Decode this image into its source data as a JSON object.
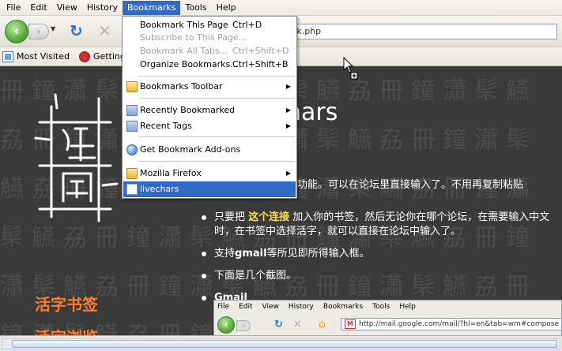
{
  "menubar": {
    "items": [
      {
        "label": "File"
      },
      {
        "label": "Edit"
      },
      {
        "label": "View"
      },
      {
        "label": "History"
      },
      {
        "label": "Bookmarks"
      },
      {
        "label": "Tools"
      },
      {
        "label": "Help"
      }
    ]
  },
  "navbar": {
    "url": "kmark.php"
  },
  "bookmarks_toolbar": {
    "items": [
      {
        "label": "Most Visited",
        "icon": "page-icon"
      },
      {
        "label": "Getting St",
        "icon": "getting-started-icon"
      }
    ]
  },
  "bookmarks_menu": {
    "items": [
      {
        "label": "Bookmark This Page",
        "shortcut": "Ctrl+D"
      },
      {
        "label": "Subscribe to This Page...",
        "shortcut": ""
      },
      {
        "label": "Bookmark All Tabs...",
        "shortcut": "Ctrl+Shift+D"
      },
      {
        "label": "Organize Bookmarks...",
        "shortcut": "Ctrl+Shift+B"
      },
      {
        "label": "Bookmarks Toolbar"
      },
      {
        "label": "Recently Bookmarked"
      },
      {
        "label": "Recent Tags"
      },
      {
        "label": "Get Bookmark Add-ons"
      },
      {
        "label": "Mozilla Firefox"
      },
      {
        "label": "livechars"
      }
    ]
  },
  "content": {
    "heading": "hars",
    "intro": "功能。可以在论坛里直接输入了。不用再复制粘贴",
    "bullets": {
      "b1_pre": "只要把 ",
      "b1_link": "这个连接",
      "b1_post": " 加入你的书签，然后无论你在哪个论坛，在需要输入中文时，在书签中选择活字，就可以直接在论坛中输入了。",
      "b2_bold": "gmail",
      "b2_pre": "支持",
      "b2_post": "等所见即所得输入框。",
      "b3": "下面是几个截图。",
      "b4": "Gmail"
    },
    "side_title": "活字书签",
    "side_title2": "活字浏览",
    "bg_pattern": "冊鐘瀟䯱觾劦冊鐘瀟䯱觾劦冊鐘瀟䯱觾劦冊鐘瀟䯱觾劦冊鐘瀟䯱觾劦冊鐘瀟䯱觾劦冊鐘瀟䯱觾劦冊鐘瀟䯱觾劦冊鐘瀟䯱觾劦冊鐘瀟䯱觾劦冊鐘瀟䯱觾劦冊鐘瀟䯱觾劦冊鐘瀟䯱觾劦冊鐘瀟䯱觾劦冊鐘瀟䯱觾劦冊鐘瀟䯱觾劦"
  },
  "embedded_browser": {
    "menu": [
      "File",
      "Edit",
      "View",
      "History",
      "Bookmarks",
      "Tools",
      "Help"
    ],
    "url": "http://mail.google.com/mail/?hl=en&tab=wm#compose"
  },
  "colors": {
    "accent": "#316ac5",
    "heading_orange": "#ff7a2a",
    "highlight_yellow": "#ffe14a"
  }
}
